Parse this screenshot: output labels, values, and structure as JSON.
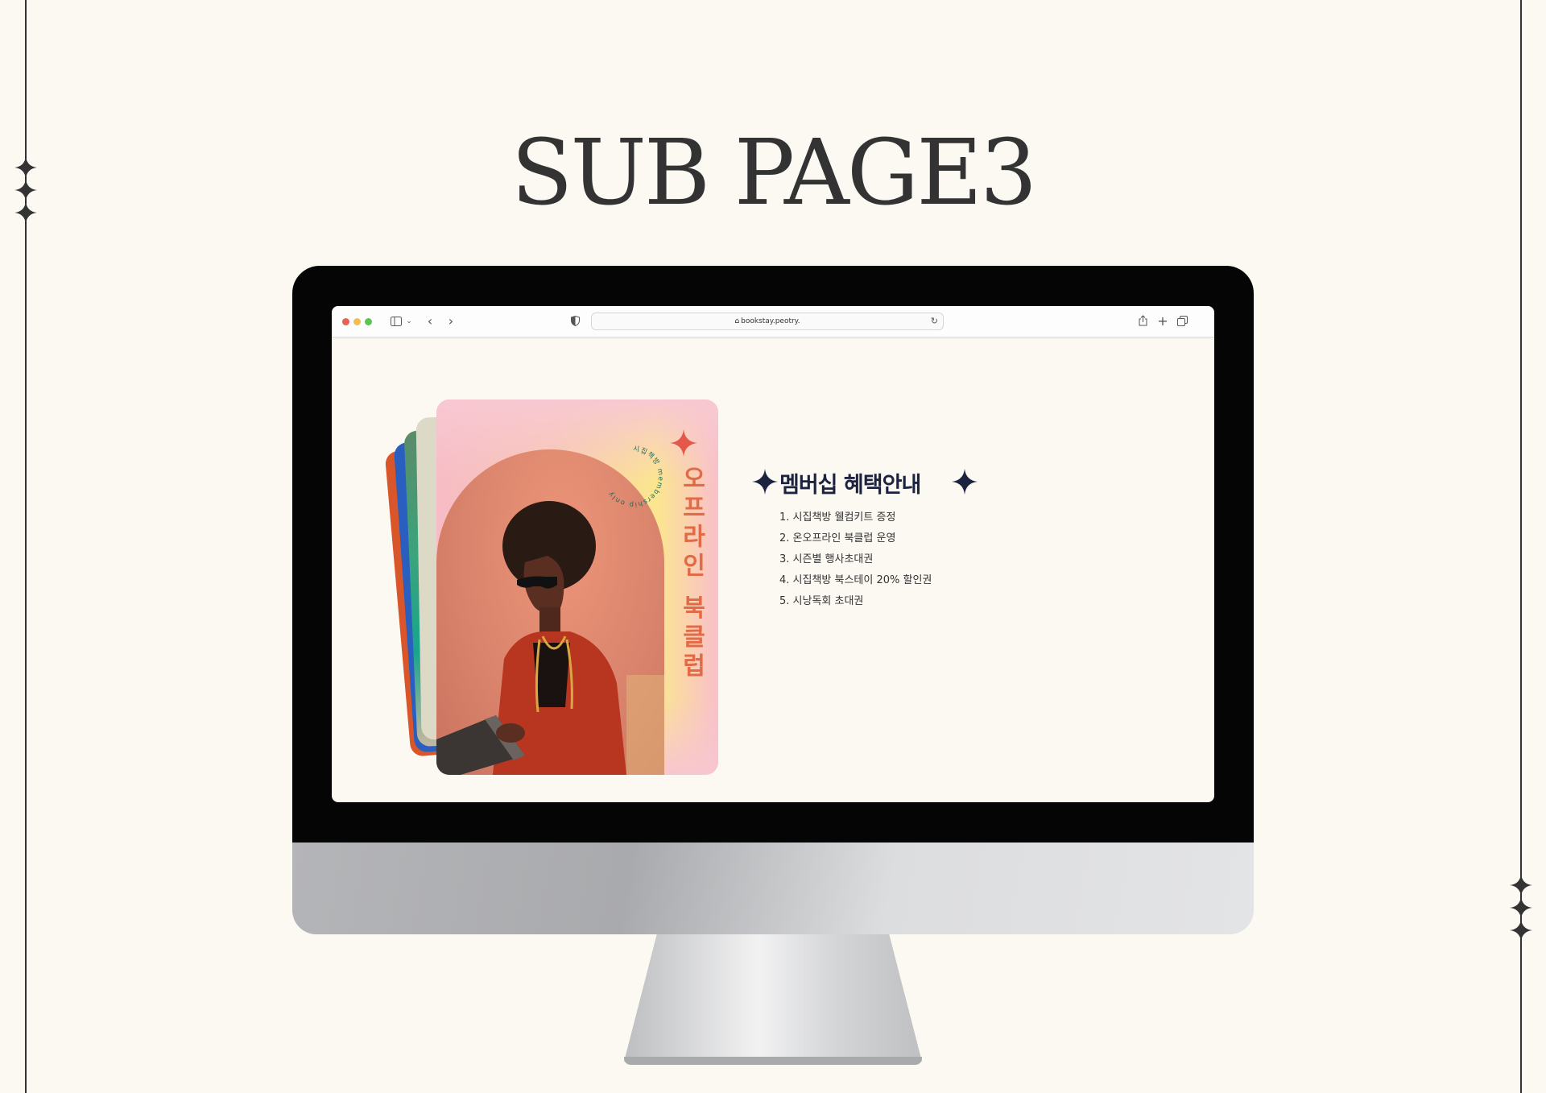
{
  "page": {
    "title": "SUB PAGE3"
  },
  "browser": {
    "url": "bookstay.peotry.",
    "toolbar_icons": [
      "sidebar-icon",
      "chevron-down-icon",
      "back-icon",
      "forward-icon",
      "shield-icon",
      "lock-icon",
      "reload-icon",
      "share-icon",
      "new-tab-icon",
      "tabs-overview-icon"
    ]
  },
  "card": {
    "vertical_title": "오프라인 북클럽",
    "circular_text": "시집책방 membership only"
  },
  "benefits": {
    "heading": "멤버십 혜택안내",
    "items": [
      "1. 시집책방 웰컴키트 증정",
      "2. 온오프라인 북클럽 운영",
      "3. 시즌별 행사초대권",
      "4. 시집책방 북스테이 20% 할인권",
      "5. 시낭독회 초대권"
    ]
  },
  "colors": {
    "background": "#fcf8f2",
    "accent_orange": "#e26a47",
    "heading_navy": "#1c2340",
    "card_pink": "#f7bcc6",
    "card_yellow": "#fbe68f"
  }
}
